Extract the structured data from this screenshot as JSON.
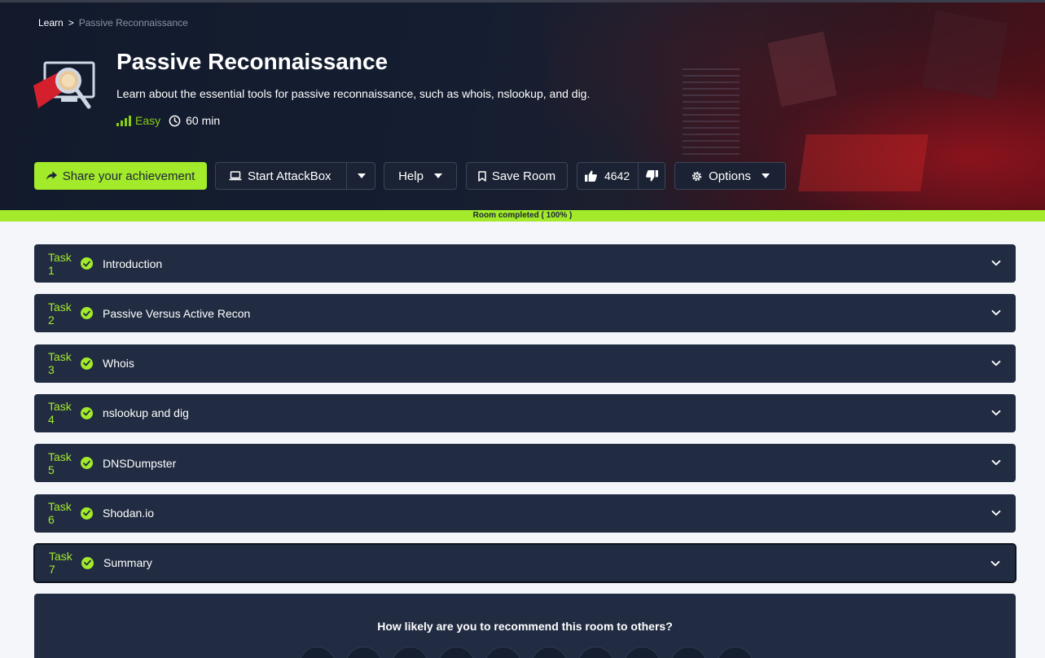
{
  "breadcrumb": {
    "root": "Learn",
    "separator": ">",
    "current": "Passive Reconnaissance"
  },
  "room": {
    "title": "Passive Reconnaissance",
    "description": "Learn about the essential tools for passive reconnaissance, such as whois, nslookup, and dig.",
    "difficulty": "Easy",
    "duration": "60 min"
  },
  "toolbar": {
    "share_label": "Share your achievement",
    "attackbox_label": "Start AttackBox",
    "help_label": "Help",
    "save_label": "Save Room",
    "upvotes": "4642",
    "options_label": "Options"
  },
  "progress": {
    "label": "Room completed ( 100% )",
    "value": 1.0
  },
  "tasks": [
    {
      "number": "Task 1",
      "title": "Introduction"
    },
    {
      "number": "Task 2",
      "title": "Passive Versus Active Recon"
    },
    {
      "number": "Task 3",
      "title": "Whois"
    },
    {
      "number": "Task 4",
      "title": "nslookup and dig"
    },
    {
      "number": "Task 5",
      "title": "DNSDumpster"
    },
    {
      "number": "Task 6",
      "title": "Shodan.io"
    },
    {
      "number": "Task 7",
      "title": "Summary"
    }
  ],
  "feedback": {
    "question": "How likely are you to recommend this room to others?"
  },
  "colors": {
    "accent": "#a3ea2a",
    "task_bg": "#212c42",
    "hero_bg": "#151e31"
  },
  "icons": [
    "share-icon",
    "laptop-icon",
    "bookmark-icon",
    "thumbs-up-icon",
    "thumbs-down-icon",
    "gear-icon",
    "clock-icon",
    "check-circle-icon",
    "chevron-down-icon"
  ]
}
